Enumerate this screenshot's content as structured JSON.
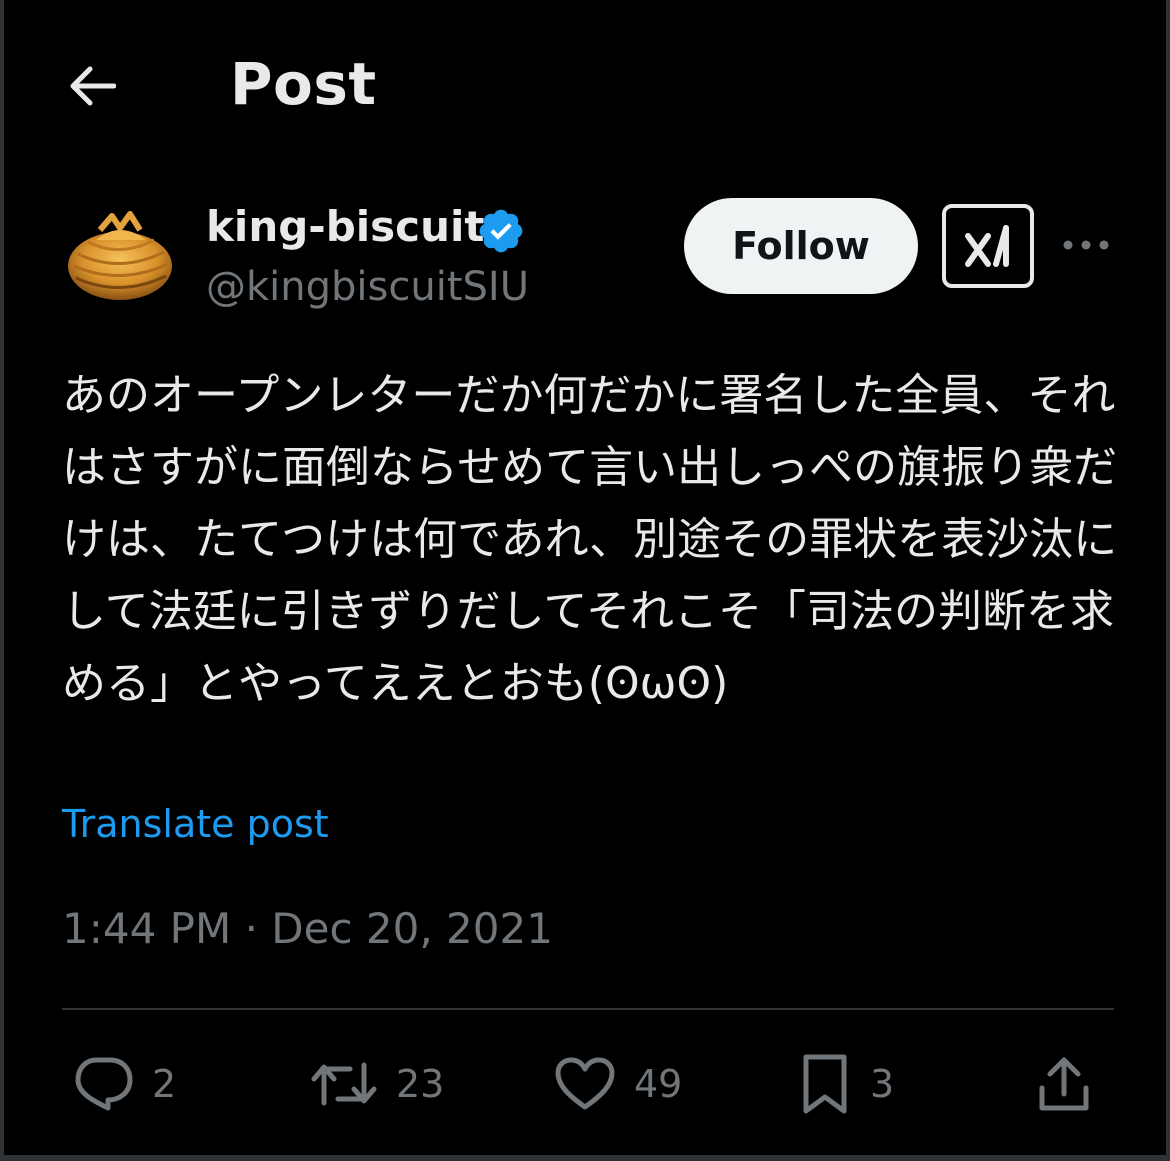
{
  "header": {
    "title": "Post",
    "back_icon": "arrow-left-icon"
  },
  "author": {
    "display_name": "king-biscuit",
    "handle": "@kingbiscuitSIU",
    "verified": true,
    "verified_color": "#1d9bf0"
  },
  "actions_top": {
    "follow_label": "Follow",
    "grok_icon": "grok-icon",
    "more_icon": "more-dots-icon"
  },
  "post": {
    "text": "あのオープンレターだか何だかに署名した全員、それはさすがに面倒ならせめて言い出しっぺの旗振り衆だけは、たてつけは何であれ、別途その罪状を表沙汰にして法廷に引きずりだしてそれこそ「司法の判断を求める」とやってええとおも(ʘωʘ)",
    "translate_label": "Translate post",
    "timestamp": "1:44 PM · Dec 20, 2021"
  },
  "stats": {
    "replies": "2",
    "reposts": "23",
    "likes": "49",
    "bookmarks": "3"
  },
  "colors": {
    "background": "#000000",
    "text_primary": "#e7e9ea",
    "text_secondary": "#71767b",
    "link": "#1d9bf0",
    "divider": "#2f3336"
  }
}
